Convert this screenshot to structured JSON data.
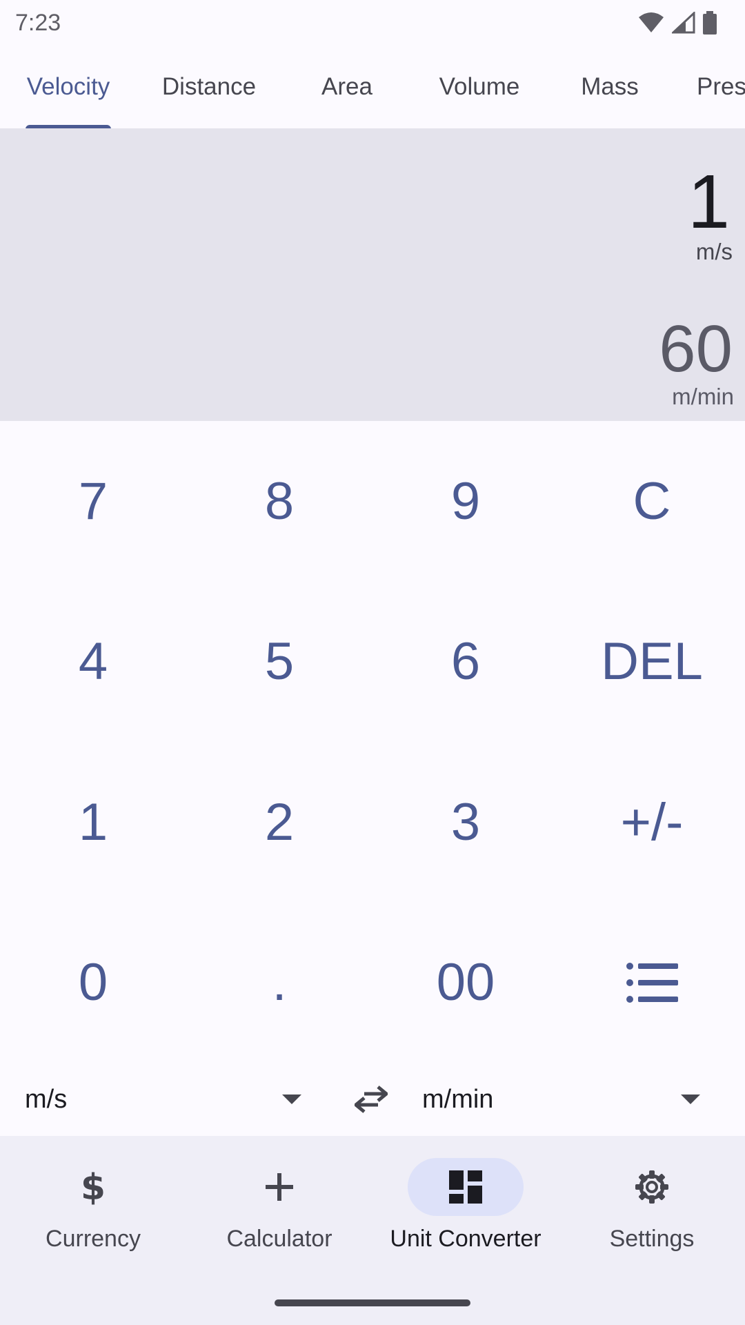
{
  "status_bar": {
    "time": "7:23",
    "icons": [
      "wifi-icon",
      "cell-signal-icon",
      "battery-icon"
    ]
  },
  "tabs": [
    {
      "label": "Velocity",
      "active": true
    },
    {
      "label": "Distance",
      "active": false
    },
    {
      "label": "Area",
      "active": false
    },
    {
      "label": "Volume",
      "active": false
    },
    {
      "label": "Mass",
      "active": false
    },
    {
      "label": "Pres",
      "active": false
    }
  ],
  "display": {
    "input_value": "1",
    "input_unit": "m/s",
    "output_value": "60",
    "output_unit": "m/min"
  },
  "keypad": {
    "keys": [
      "7",
      "8",
      "9",
      "C",
      "4",
      "5",
      "6",
      "DEL",
      "1",
      "2",
      "3",
      "+/-",
      "0",
      ".",
      "00"
    ],
    "last_key_icon": "list-icon"
  },
  "units": {
    "from": "m/s",
    "to": "m/min",
    "swap_icon": "swap-arrows-icon",
    "dropdown_icon": "dropdown-arrow-icon"
  },
  "bottom_nav": [
    {
      "label": "Currency",
      "icon": "dollar-icon",
      "active": false
    },
    {
      "label": "Calculator",
      "icon": "plus-icon",
      "active": false
    },
    {
      "label": "Unit Converter",
      "icon": "dashboard-icon",
      "active": true
    },
    {
      "label": "Settings",
      "icon": "gear-icon",
      "active": false
    }
  ],
  "colors": {
    "accent": "#4b5a92",
    "display_bg": "#e4e3ec",
    "nav_bg": "#efeef7",
    "nav_active_pill": "#dde1f9",
    "page_bg": "#fcfaff"
  }
}
